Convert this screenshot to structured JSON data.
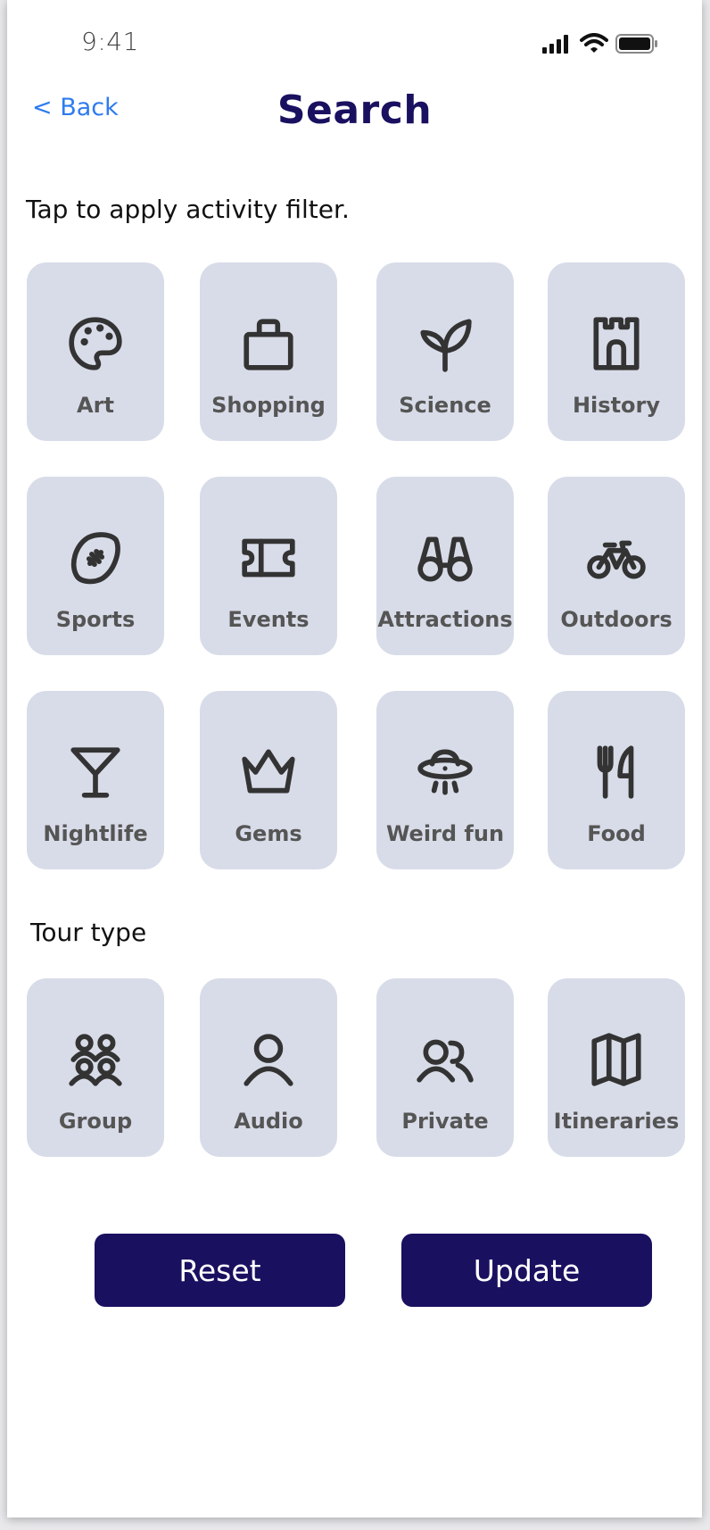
{
  "status_bar": {
    "time": "9:41"
  },
  "header": {
    "back_label": "< Back",
    "title": "Search"
  },
  "activity_section": {
    "instruction": "Tap to apply activity filter.",
    "tiles": [
      {
        "label": "Art",
        "icon": "palette-icon"
      },
      {
        "label": "Shopping",
        "icon": "shopping-bag-icon"
      },
      {
        "label": "Science",
        "icon": "leaf-icon"
      },
      {
        "label": "History",
        "icon": "castle-icon"
      },
      {
        "label": "Sports",
        "icon": "football-icon"
      },
      {
        "label": "Events",
        "icon": "ticket-icon"
      },
      {
        "label": "Attractions",
        "icon": "binoculars-icon"
      },
      {
        "label": "Outdoors",
        "icon": "bicycle-icon"
      },
      {
        "label": "Nightlife",
        "icon": "cocktail-icon"
      },
      {
        "label": "Gems",
        "icon": "crown-icon"
      },
      {
        "label": "Weird fun",
        "icon": "ufo-icon"
      },
      {
        "label": "Food",
        "icon": "fork-knife-icon"
      }
    ]
  },
  "tour_section": {
    "title": "Tour type",
    "tiles": [
      {
        "label": "Group",
        "icon": "group-icon"
      },
      {
        "label": "Audio",
        "icon": "person-icon"
      },
      {
        "label": "Private",
        "icon": "two-people-icon"
      },
      {
        "label": "Itineraries",
        "icon": "map-icon"
      }
    ]
  },
  "actions": {
    "reset_label": "Reset",
    "update_label": "Update"
  },
  "colors": {
    "brand": "#1a1060",
    "tile_bg": "#d8dce8",
    "link": "#2f7bf0"
  }
}
